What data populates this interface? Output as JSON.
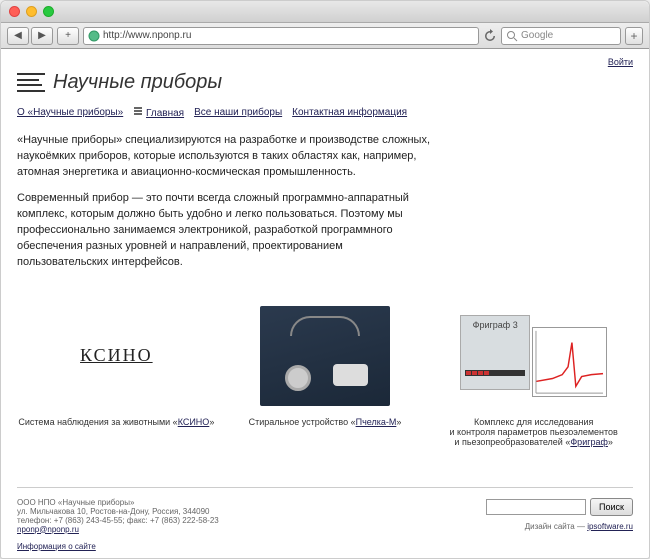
{
  "browser": {
    "url": "http://www.nponp.ru",
    "search_placeholder": "Google"
  },
  "login_link": "Войти",
  "site_title": "Научные приборы",
  "nav": {
    "about": "О «Научные приборы»",
    "home": "Главная",
    "all_devices": "Все наши приборы",
    "contact": "Контактная информация"
  },
  "content": {
    "p1": "«Научные приборы» специализируются на разработке и производстве сложных, наукоёмких приборов, которые используются в таких областях как, например, атомная энергетика и авиационно-космическая промышленность.",
    "p2": "Современный прибор — это почти всегда сложный программно-аппаратный комплекс, которым должно быть удобно и легко пользоваться. Поэтому мы профессионально занимаемся электроникой, разработкой программного обеспечения разных уровней и направлений, проектированием пользовательских интерфейсов."
  },
  "products": {
    "ksino": {
      "logo": "КСИНО",
      "caption_prefix": "Система наблюдения за животными «",
      "caption_link": "КСИНО",
      "caption_suffix": "»"
    },
    "pchelka": {
      "caption_prefix": "Стиральное устройство «",
      "caption_link": "Пчелка-М",
      "caption_suffix": "»"
    },
    "frigraf": {
      "box_title": "Фриграф 3",
      "caption_l1": "Комплекс для исследования",
      "caption_l2": "и контроля параметров пьезоэлементов",
      "caption_l3_prefix": "и пьезопреобразователей «",
      "caption_l3_link": "Фриграф",
      "caption_l3_suffix": "»"
    }
  },
  "footer": {
    "company": "ООО НПО «Научные приборы»",
    "address": "ул. Мильчакова 10, Ростов-на-Дону, Россия, 344090",
    "phone": "телефон: +7 (863) 243-45-55; факс: +7 (863) 222-58-23",
    "email": "nponp@nponp.ru",
    "site_info": "Информация о сайте",
    "search_button": "Поиск",
    "design_prefix": "Дизайн сайта — ",
    "design_link": "ipsoftware.ru"
  }
}
